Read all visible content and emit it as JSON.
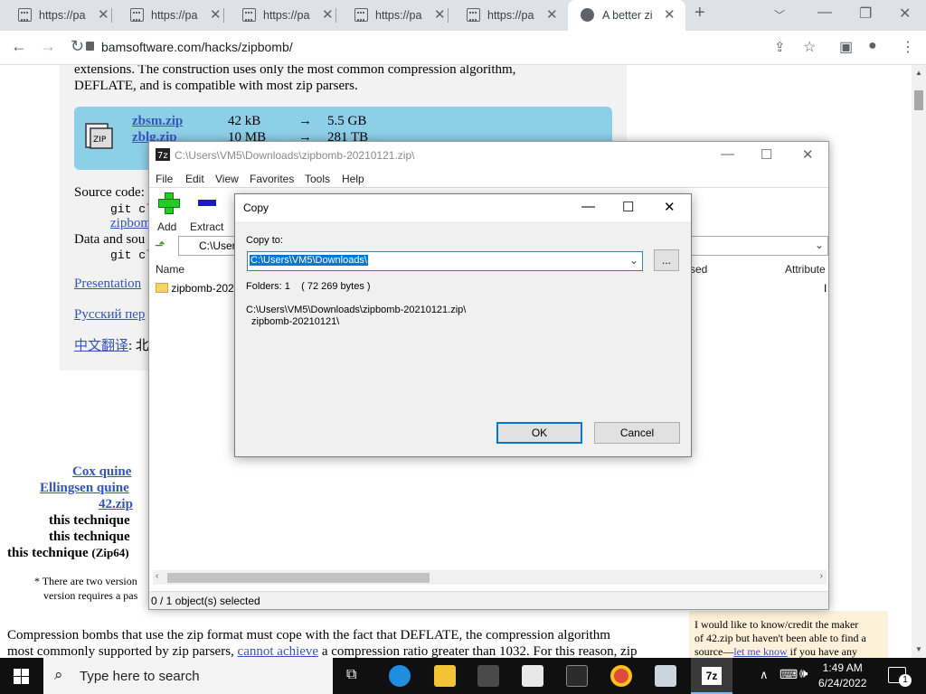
{
  "browser": {
    "tabs": [
      {
        "label": "https://pas"
      },
      {
        "label": "https://pas"
      },
      {
        "label": "https://pas"
      },
      {
        "label": "https://pas"
      },
      {
        "label": "https://pas"
      },
      {
        "label": "A better zi"
      }
    ],
    "url": "bamsoftware.com/hacks/zipbomb/"
  },
  "page": {
    "intro_line1": "extensions. The construction uses only the most common compression algorithm,",
    "intro_line2": "DEFLATE, and is compatible with most zip parsers.",
    "downloads": [
      {
        "name": "zbsm.zip",
        "size": "42 kB",
        "arrow": "→",
        "unzipped": "5.5 GB"
      },
      {
        "name": "zblg.zip",
        "size": "10 MB",
        "arrow": "→",
        "unzipped": "281 TB"
      }
    ],
    "source_label": "Source code:",
    "git1": "git cl",
    "zipbomb_link": "zipbom",
    "data_label": "Data and sou",
    "git2": "git cl",
    "presentation_link": "Presentation",
    "russian_link": "Русский пер",
    "chinese_link": "中文翻译",
    "chinese_rest": ": 北",
    "refs": [
      "Cox quine",
      "Ellingsen quine",
      "42.zip"
    ],
    "techniques": [
      "this technique",
      "this technique",
      "this technique"
    ],
    "zip64": "(Zip64)",
    "footnote1": "* There are two version",
    "footnote2": "version requires a pas",
    "body1": "Compression bombs that use the zip format must cope with the fact that DEFLATE, the compression algorithm",
    "body2_pre": "most commonly supported by zip parsers,",
    "body2_link": "cannot achieve",
    "body2_post": "a compression ratio greater than 1032. For this reason, zip",
    "note_l1": "I would like to know/credit the maker",
    "note_l2": "of 42.zip but haven't been able to find a",
    "note_l3_pre": "source—",
    "note_l3_link": "let me know",
    "note_l3_post": "if you have any"
  },
  "sevenzip": {
    "title": "C:\\Users\\VM5\\Downloads\\zipbomb-20210121.zip\\",
    "menu": [
      "File",
      "Edit",
      "View",
      "Favorites",
      "Tools",
      "Help"
    ],
    "tools": [
      "Add",
      "Extract"
    ],
    "address": "C:\\User",
    "columns": [
      "Name",
      "sed",
      "Attribute"
    ],
    "row_name": "zipbomb-2021",
    "row_attr": "I",
    "status": "0 / 1 object(s) selected"
  },
  "dialog": {
    "title": "Copy",
    "copy_to_label": "Copy to:",
    "path": "C:\\Users\\VM5\\Downloads\\",
    "browse": "...",
    "folders": "Folders: 1    ( 72 269 bytes )",
    "src1": "C:\\Users\\VM5\\Downloads\\zipbomb-20210121.zip\\",
    "src2": "zipbomb-20210121\\",
    "ok": "OK",
    "cancel": "Cancel"
  },
  "taskbar": {
    "search_placeholder": "Type here to search",
    "time": "1:49 AM",
    "date": "6/24/2022",
    "notification_count": "1"
  },
  "colors": {
    "tab_strip": "#dee1e6",
    "accent": "#0078d7",
    "link": "#3355bb",
    "download_box": "#8ecfe8",
    "taskbar": "#101010"
  }
}
